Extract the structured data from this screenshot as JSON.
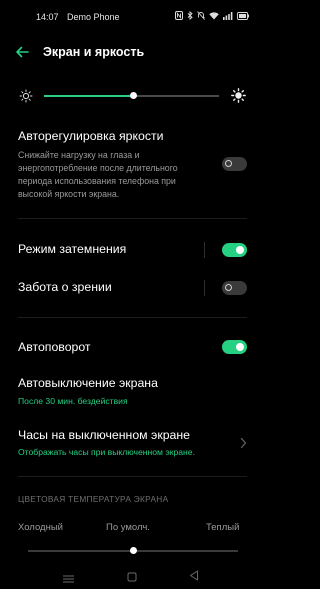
{
  "status_bar": {
    "time": "14:07",
    "carrier": "Demo Phone",
    "battery_icon": "battery-icon"
  },
  "header": {
    "title": "Экран и яркость"
  },
  "brightness": {
    "level_percent": 51
  },
  "auto_brightness": {
    "title": "Авторегулировка яркости",
    "desc_lines": [
      "Снижайте нагрузку на глаза и",
      "энергопотребление после длительного",
      "периода использования телефона при",
      "высокой яркости экрана."
    ],
    "enabled": false
  },
  "dark_mode": {
    "title": "Режим затемнения",
    "enabled": true
  },
  "eye_care": {
    "title": "Забота о зрении",
    "enabled": false
  },
  "auto_rotate": {
    "title": "Автоповорот",
    "enabled": true
  },
  "screen_timeout": {
    "title": "Автовыключение экрана",
    "value": "После 30 мин. бездействия"
  },
  "aod": {
    "title": "Часы на выключенном экране",
    "value": "Отображать часы при выключенном экране."
  },
  "color_temp": {
    "section": "ЦВЕТОВАЯ ТЕМПЕРАТУРА ЭКРАНА",
    "cool": "Холодный",
    "default": "По умолч.",
    "warm": "Теплый",
    "level_percent": 50
  },
  "colors": {
    "accent": "#25d083",
    "background": "#000000"
  }
}
